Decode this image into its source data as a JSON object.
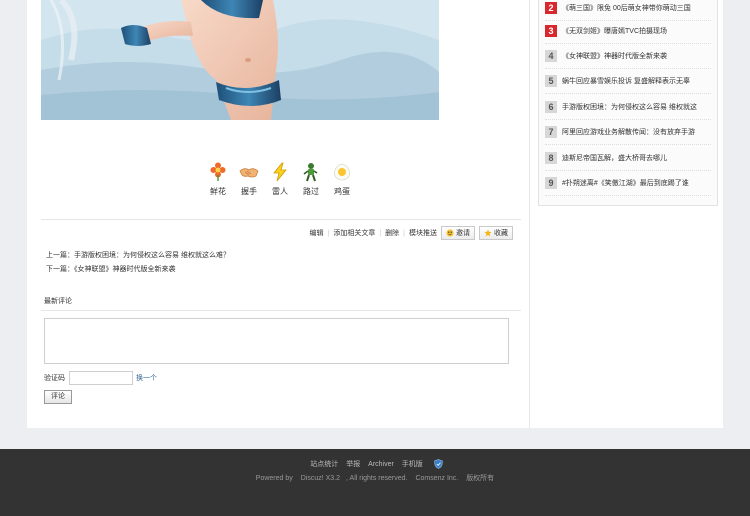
{
  "reactions": [
    {
      "icon": "flower-icon",
      "label": "鲜花"
    },
    {
      "icon": "handshake-icon",
      "label": "握手"
    },
    {
      "icon": "lightning-icon",
      "label": "雷人"
    },
    {
      "icon": "walker-icon",
      "label": "路过"
    },
    {
      "icon": "egg-icon",
      "label": "鸡蛋"
    }
  ],
  "actions": {
    "edit": "编辑",
    "add_related": "添加相关文章",
    "delete": "删除",
    "push": "模块推送",
    "invite": "邀请",
    "favorite": "收藏"
  },
  "navigation": {
    "prev": "上一篇：手游版权困境：为何侵权这么容易 维权就这么难？",
    "next": "下一篇：《女神联盟》神器时代版全新来袭"
  },
  "comments": {
    "title": "最新评论",
    "captcha_label": "验证码",
    "captcha_refresh": "换一个",
    "submit": "评论"
  },
  "sidebar": {
    "items": [
      {
        "num": "2",
        "text": "《萌三国》限免 00后萌女神带你萌动三国",
        "hot": true
      },
      {
        "num": "3",
        "text": "《无双剑姬》曝唐嫣TVC拍摄现场",
        "hot": true
      },
      {
        "num": "4",
        "text": "《女神联盟》神器时代版全新来袭",
        "hot": false
      },
      {
        "num": "5",
        "text": "蜗牛回应暴雪娱乐投诉 复盛解释表示无辜",
        "hot": false
      },
      {
        "num": "6",
        "text": "手游版权困境：为何侵权这么容易 维权就这",
        "hot": false
      },
      {
        "num": "7",
        "text": "阿里回应游戏业务解散传闻：没有放弃手游",
        "hot": false
      },
      {
        "num": "8",
        "text": "迪斯尼帝国瓦解，盛大桥哥去哪儿",
        "hot": false
      },
      {
        "num": "9",
        "text": "#扑朔迷离#《笑傲江湖》最后到底踢了谁",
        "hot": false
      }
    ]
  },
  "footer": {
    "links": [
      "站点统计",
      "举报",
      "Archiver",
      "手机版"
    ],
    "powered": "Powered by",
    "product": "Discuz! X3.2",
    "rights": ", All rights reserved.",
    "company": "Comsenz Inc.",
    "copyright": "版权所有"
  },
  "colors": {
    "hot_rank": "#d9272e",
    "cold_rank": "#d7d7d7",
    "footer_bg": "#333334",
    "link": "#336699"
  }
}
